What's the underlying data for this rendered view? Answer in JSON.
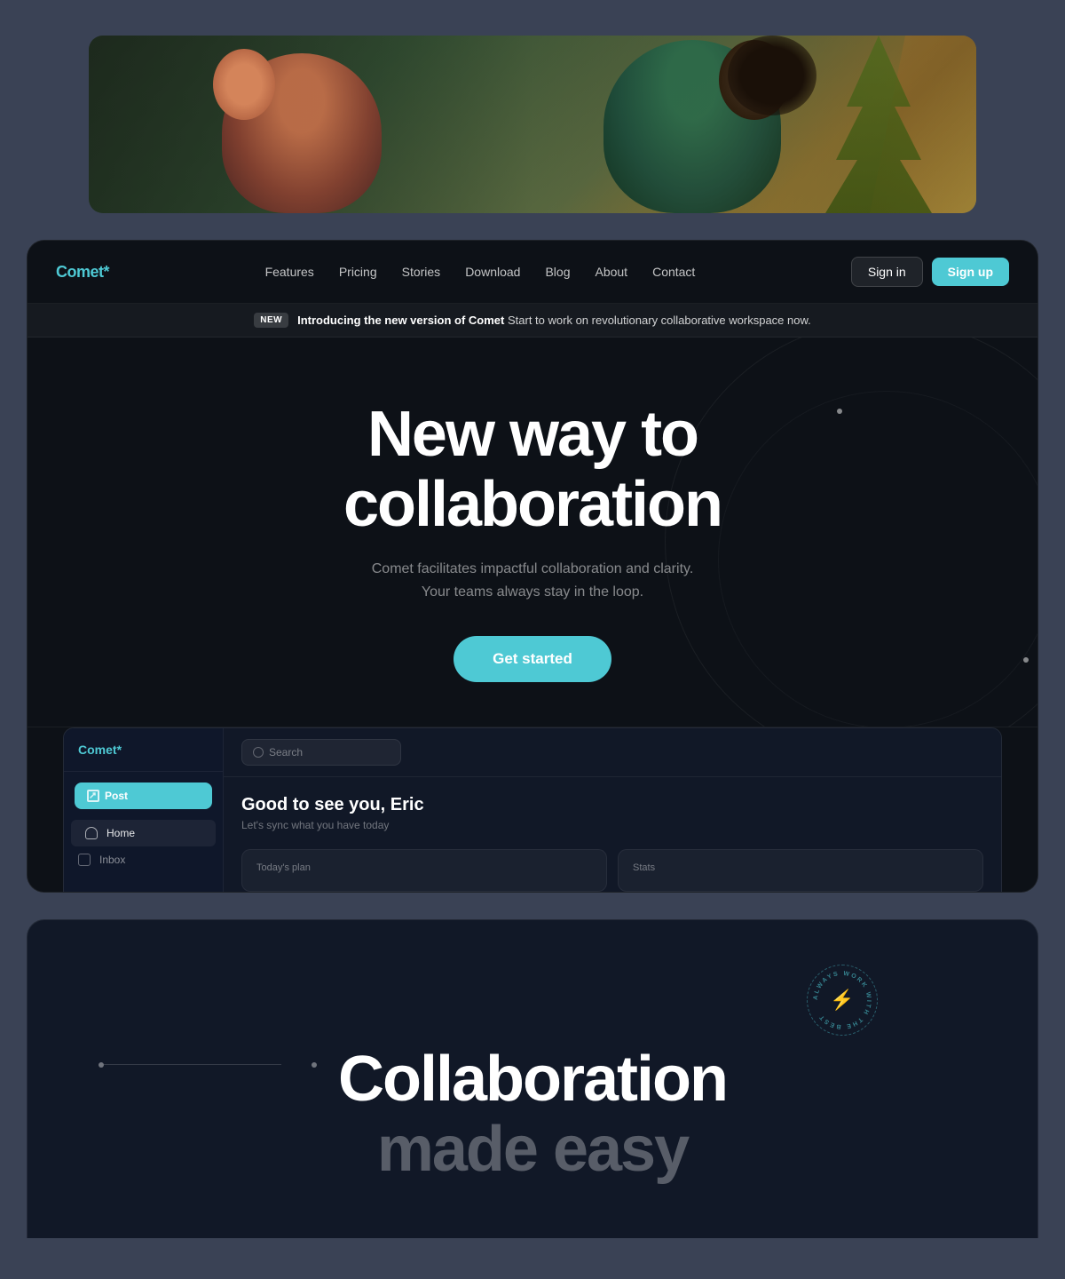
{
  "topImage": {
    "alt": "Two people collaborating and laughing"
  },
  "navbar": {
    "logo": "Comet",
    "logo_symbol": "*",
    "links": [
      {
        "label": "Features"
      },
      {
        "label": "Pricing"
      },
      {
        "label": "Stories"
      },
      {
        "label": "Download"
      },
      {
        "label": "Blog"
      },
      {
        "label": "About"
      },
      {
        "label": "Contact"
      }
    ],
    "signin_label": "Sign in",
    "signup_label": "Sign up"
  },
  "announcement": {
    "badge": "NEW",
    "bold_text": "Introducing the new version of Comet",
    "rest_text": " Start to work on revolutionary collaborative workspace now."
  },
  "hero": {
    "title_line1": "New way to",
    "title_line2": "collaboration",
    "subtitle_line1": "Comet facilitates impactful collaboration and clarity.",
    "subtitle_line2": "Your teams always stay in the loop.",
    "cta_label": "Get started"
  },
  "appPreview": {
    "sidebar": {
      "logo": "Comet",
      "logo_symbol": "*",
      "post_button": "Post",
      "nav_items": [
        {
          "label": "Home",
          "active": true
        },
        {
          "label": "Inbox"
        }
      ]
    },
    "topbar": {
      "search_placeholder": "Search"
    },
    "greeting": {
      "title": "Good to see you, Eric",
      "subtitle": "Let's sync what you have today"
    },
    "cards": [
      {
        "label": "Today's plan"
      },
      {
        "label": "Stats"
      }
    ]
  },
  "bottomSection": {
    "badge_text": "ALWAYS WORK WITH THE BEST",
    "title_line1": "Collaboration",
    "title_line2": "made easy"
  }
}
